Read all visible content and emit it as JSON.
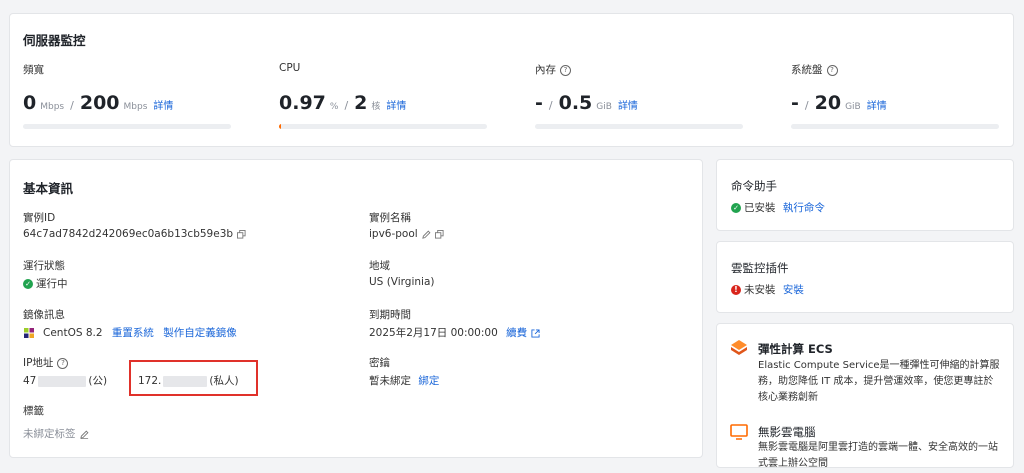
{
  "monitor": {
    "title": "伺服器監控",
    "bandwidth": {
      "label": "頻寬",
      "used": "0",
      "used_unit": "Mbps",
      "sep": "/",
      "total": "200",
      "total_unit": "Mbps",
      "link": "詳情",
      "usage": 0
    },
    "cpu": {
      "label": "CPU",
      "used": "0.97",
      "used_unit": "%",
      "sep": "/",
      "total": "2",
      "total_unit": "核",
      "link": "詳情",
      "usage": 0.0097
    },
    "memory": {
      "label": "內存",
      "used": "-",
      "sep": "/",
      "total": "0.5",
      "total_unit": "GiB",
      "link": "詳情",
      "usage": 0
    },
    "disk": {
      "label": "系統盤",
      "used": "-",
      "sep": "/",
      "total": "20",
      "total_unit": "GiB",
      "link": "詳情",
      "usage": 0
    }
  },
  "basic": {
    "title": "基本資訊",
    "instance_id": {
      "label": "實例ID",
      "value": "64c7ad7842d242069ec0a6b13cb59e3b"
    },
    "instance_name": {
      "label": "實例名稱",
      "value": "ipv6-pool"
    },
    "status": {
      "label": "運行狀態",
      "value": "運行中"
    },
    "region": {
      "label": "地域",
      "value": "US (Virginia)"
    },
    "image": {
      "label": "鏡像訊息",
      "value": "CentOS 8.2",
      "link1": "重置系統",
      "link2": "製作自定義鏡像"
    },
    "expire": {
      "label": "到期時間",
      "value": "2025年2月17日 00:00:00",
      "link": "續費"
    },
    "ip": {
      "label": "IP地址",
      "public_prefix": "47",
      "public_suffix": "(公)",
      "private_prefix": "172.",
      "private_suffix": "(私人)"
    },
    "key": {
      "label": "密鑰",
      "value": "暫未綁定",
      "link": "綁定"
    },
    "tags": {
      "label": "標籤",
      "value": "未綁定标签"
    }
  },
  "command": {
    "title": "命令助手",
    "status": "已安裝",
    "link": "執行命令"
  },
  "cloudmon": {
    "title": "雲監控插件",
    "status": "未安裝",
    "link": "安裝"
  },
  "products": [
    {
      "name": "彈性計算 ECS",
      "desc": "Elastic Compute Service是一種彈性可伸縮的計算服務，助您降低 IT 成本，提升營運效率，使您更專註於核心業務創新"
    },
    {
      "name": "無影雲電腦",
      "desc": "無影雲電腦是阿里雲打造的雲端一體、安全高效的一站式雲上辦公空間"
    }
  ],
  "colors": {
    "accent": "#ff6a00",
    "link": "#1a66d9",
    "ok": "#21a34f",
    "error": "#d9251c",
    "highlight_box": "#e0312a"
  }
}
